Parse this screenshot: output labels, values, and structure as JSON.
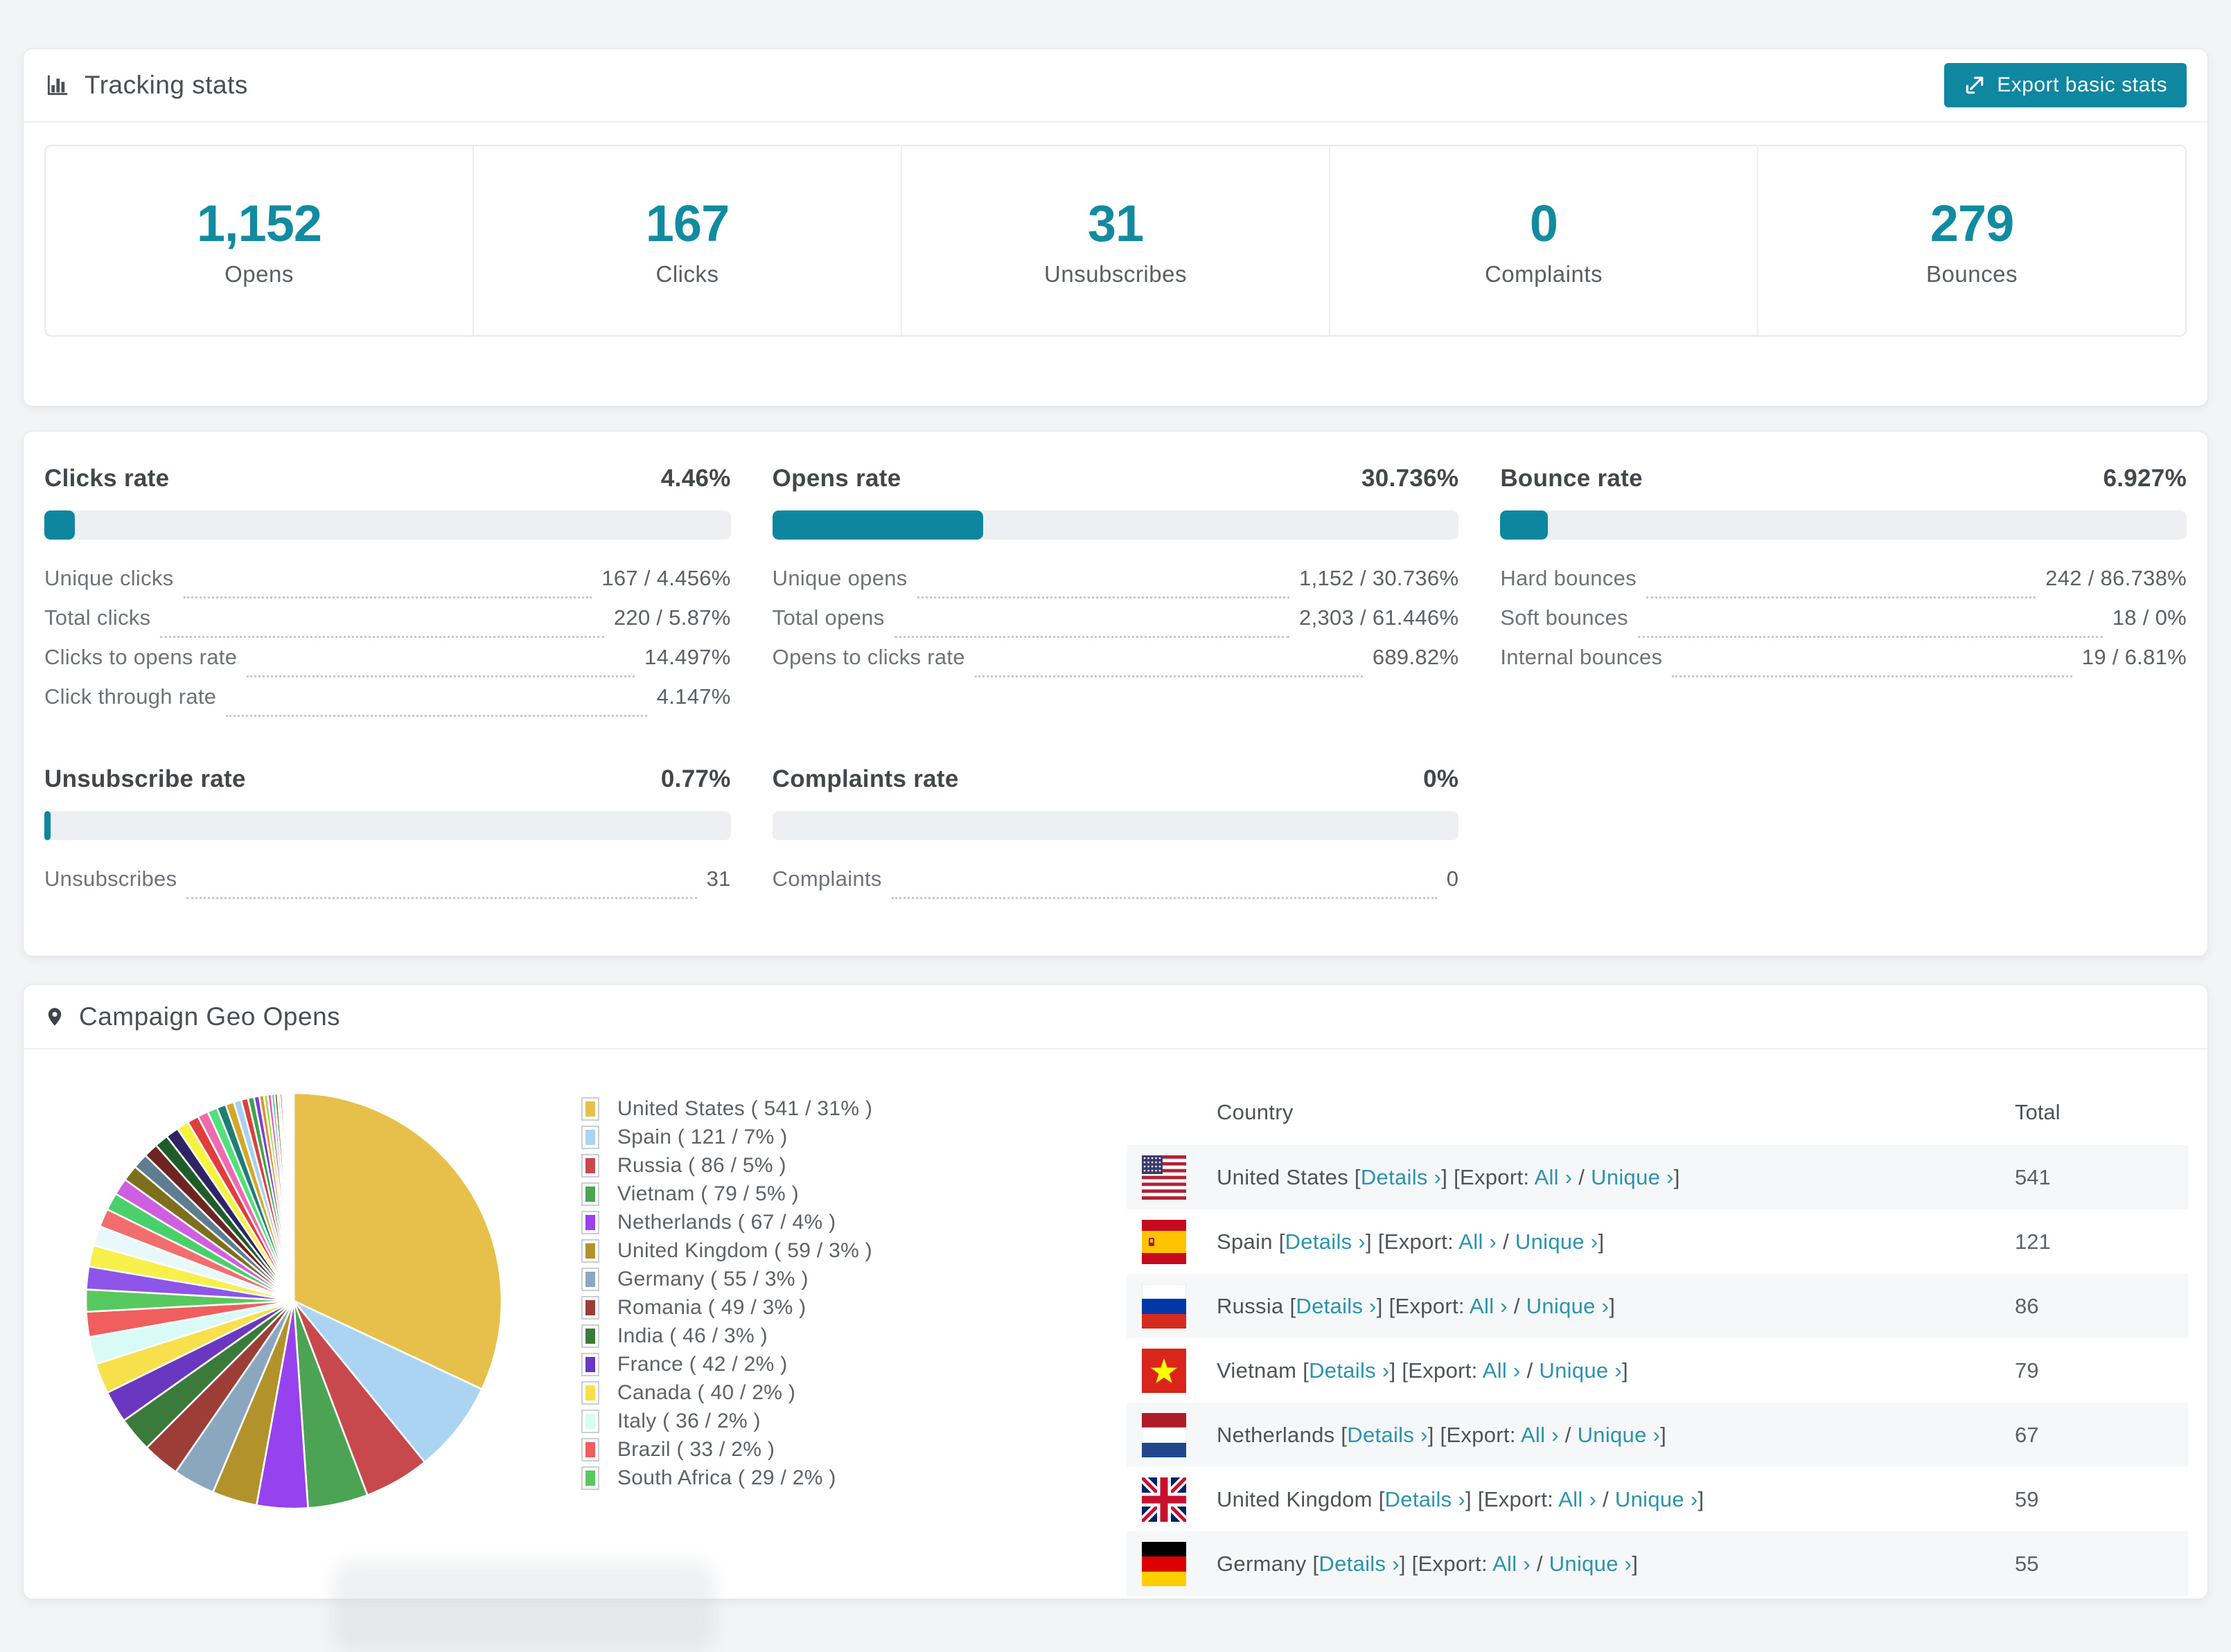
{
  "tracking": {
    "title": "Tracking stats",
    "export_button": "Export basic stats",
    "stats": [
      {
        "value": "1,152",
        "label": "Opens"
      },
      {
        "value": "167",
        "label": "Clicks"
      },
      {
        "value": "31",
        "label": "Unsubscribes"
      },
      {
        "value": "0",
        "label": "Complaints"
      },
      {
        "value": "279",
        "label": "Bounces"
      }
    ]
  },
  "rates": {
    "blocks": [
      {
        "title": "Clicks rate",
        "value": "4.46%",
        "percent": 4.46,
        "rows": [
          {
            "label": "Unique clicks",
            "value": "167 / 4.456%"
          },
          {
            "label": "Total clicks",
            "value": "220 / 5.87%"
          },
          {
            "label": "Clicks to opens rate",
            "value": "14.497%"
          },
          {
            "label": "Click through rate",
            "value": "4.147%"
          }
        ]
      },
      {
        "title": "Opens rate",
        "value": "30.736%",
        "percent": 30.736,
        "rows": [
          {
            "label": "Unique opens",
            "value": "1,152 / 30.736%"
          },
          {
            "label": "Total opens",
            "value": "2,303 / 61.446%"
          },
          {
            "label": "Opens to clicks rate",
            "value": "689.82%"
          }
        ]
      },
      {
        "title": "Bounce rate",
        "value": "6.927%",
        "percent": 6.927,
        "rows": [
          {
            "label": "Hard bounces",
            "value": "242 / 86.738%"
          },
          {
            "label": "Soft bounces",
            "value": "18 / 0%"
          },
          {
            "label": "Internal bounces",
            "value": "19 / 6.81%"
          }
        ]
      },
      {
        "title": "Unsubscribe rate",
        "value": "0.77%",
        "percent": 0.77,
        "rows": [
          {
            "label": "Unsubscribes",
            "value": "31"
          }
        ]
      },
      {
        "title": "Complaints rate",
        "value": "0%",
        "percent": 0,
        "rows": [
          {
            "label": "Complaints",
            "value": "0"
          }
        ]
      }
    ]
  },
  "geo": {
    "title": "Campaign Geo Opens",
    "chart_data": {
      "type": "pie",
      "title": "Campaign Geo Opens",
      "legend_position": "right",
      "start_angle_deg": 0,
      "direction": "clockwise",
      "slices": [
        {
          "label": "United States",
          "value": 541,
          "pct": "31%",
          "color": "#e6c04a",
          "flag": "us"
        },
        {
          "label": "Spain",
          "value": 121,
          "pct": "7%",
          "color": "#abd3f2",
          "flag": "es"
        },
        {
          "label": "Russia",
          "value": 86,
          "pct": "5%",
          "color": "#c8494d",
          "flag": "ru"
        },
        {
          "label": "Vietnam",
          "value": 79,
          "pct": "5%",
          "color": "#4ba353",
          "flag": "vn"
        },
        {
          "label": "Netherlands",
          "value": 67,
          "pct": "4%",
          "color": "#9643ef",
          "flag": "nl"
        },
        {
          "label": "United Kingdom",
          "value": 59,
          "pct": "3%",
          "color": "#b2922b",
          "flag": "gb"
        },
        {
          "label": "Germany",
          "value": 55,
          "pct": "3%",
          "color": "#8ba7bf",
          "flag": "de"
        },
        {
          "label": "Romania",
          "value": 49,
          "pct": "3%",
          "color": "#9c3d38",
          "flag": "ro"
        },
        {
          "label": "India",
          "value": 46,
          "pct": "3%",
          "color": "#3a7a3a",
          "flag": "in"
        },
        {
          "label": "France",
          "value": 42,
          "pct": "2%",
          "color": "#6a37c0",
          "flag": "fr"
        },
        {
          "label": "Canada",
          "value": 40,
          "pct": "2%",
          "color": "#f7e04b",
          "flag": "ca"
        },
        {
          "label": "Italy",
          "value": 36,
          "pct": "2%",
          "color": "#d8fbf6",
          "flag": "it"
        },
        {
          "label": "Brazil",
          "value": 33,
          "pct": "2%",
          "color": "#f15e5e",
          "flag": "br"
        },
        {
          "label": "South Africa",
          "value": 29,
          "pct": "2%",
          "color": "#57c95e",
          "flag": "za"
        }
      ],
      "other_slices": {
        "note": "long tail of smaller countries (unlabeled in legend)",
        "values": [
          30,
          28,
          26,
          24,
          23,
          22,
          21,
          20,
          19,
          18,
          17,
          16,
          15,
          14,
          13,
          12,
          11,
          10,
          9,
          8,
          7,
          6,
          5,
          5,
          4,
          4,
          3,
          3,
          2,
          2,
          2,
          1,
          1,
          1,
          1,
          1,
          1,
          1,
          1,
          1
        ],
        "colors": [
          "#8d55e8",
          "#f7ef4a",
          "#e8f8fb",
          "#f26d6d",
          "#49d06b",
          "#cf5fe0",
          "#7d6f1c",
          "#5f7d91",
          "#6e2420",
          "#1f5c2a",
          "#2e2363",
          "#f7f23e",
          "#e23c3c",
          "#f06ab0",
          "#52e07a",
          "#1c7f72",
          "#d2a72a",
          "#a8d0f0",
          "#d94040",
          "#3fa34d",
          "#7a3fd4",
          "#e78a2e",
          "#9adf3e",
          "#e35db4",
          "#35c4c0",
          "#8b6c20",
          "#c4c8f0",
          "#b03535",
          "#4a8f3c",
          "#5533aa",
          "#efc93d",
          "#dd5050",
          "#66d9e8",
          "#7f4fd8",
          "#caa84f",
          "#ef9ebe",
          "#3bb273",
          "#274690",
          "#d66e3c",
          "#9b9b3c"
        ]
      }
    },
    "legend_format": "{label} ( {value} / {pct} )",
    "table": {
      "headers": [
        "Country",
        "Total"
      ],
      "links": {
        "details": "Details ›",
        "export_prefix": "Export:",
        "all": "All ›",
        "unique": "Unique ›"
      },
      "rows": [
        {
          "country": "United States",
          "flag": "us",
          "total": "541"
        },
        {
          "country": "Spain",
          "flag": "es",
          "total": "121"
        },
        {
          "country": "Russia",
          "flag": "ru",
          "total": "86"
        },
        {
          "country": "Vietnam",
          "flag": "vn",
          "total": "79"
        },
        {
          "country": "Netherlands",
          "flag": "nl",
          "total": "67"
        },
        {
          "country": "United Kingdom",
          "flag": "gb",
          "total": "59"
        },
        {
          "country": "Germany",
          "flag": "de",
          "total": "55"
        }
      ]
    }
  },
  "colors": {
    "accent_teal": "#0f87a0",
    "stat_number": "#128ba1",
    "link_teal": "#2a93ae",
    "bar_track": "#edf0f3",
    "page_bg": "#f3f4f6",
    "row_stripe": "#f6f7f8"
  }
}
